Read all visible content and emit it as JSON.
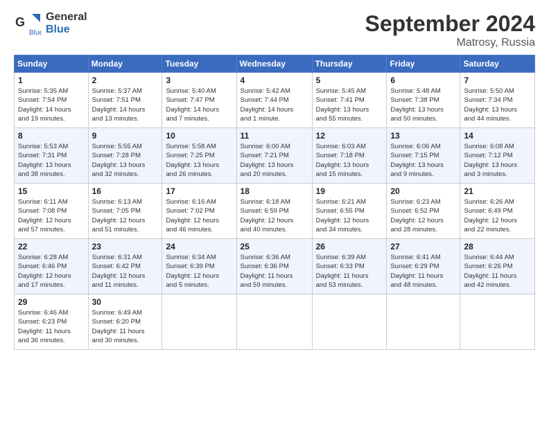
{
  "logo": {
    "line1": "General",
    "line2": "Blue"
  },
  "title": "September 2024",
  "location": "Matrosy, Russia",
  "days_of_week": [
    "Sunday",
    "Monday",
    "Tuesday",
    "Wednesday",
    "Thursday",
    "Friday",
    "Saturday"
  ],
  "weeks": [
    [
      {
        "day": "1",
        "info": "Sunrise: 5:35 AM\nSunset: 7:54 PM\nDaylight: 14 hours\nand 19 minutes."
      },
      {
        "day": "2",
        "info": "Sunrise: 5:37 AM\nSunset: 7:51 PM\nDaylight: 14 hours\nand 13 minutes."
      },
      {
        "day": "3",
        "info": "Sunrise: 5:40 AM\nSunset: 7:47 PM\nDaylight: 14 hours\nand 7 minutes."
      },
      {
        "day": "4",
        "info": "Sunrise: 5:42 AM\nSunset: 7:44 PM\nDaylight: 14 hours\nand 1 minute."
      },
      {
        "day": "5",
        "info": "Sunrise: 5:45 AM\nSunset: 7:41 PM\nDaylight: 13 hours\nand 55 minutes."
      },
      {
        "day": "6",
        "info": "Sunrise: 5:48 AM\nSunset: 7:38 PM\nDaylight: 13 hours\nand 50 minutes."
      },
      {
        "day": "7",
        "info": "Sunrise: 5:50 AM\nSunset: 7:34 PM\nDaylight: 13 hours\nand 44 minutes."
      }
    ],
    [
      {
        "day": "8",
        "info": "Sunrise: 5:53 AM\nSunset: 7:31 PM\nDaylight: 13 hours\nand 38 minutes."
      },
      {
        "day": "9",
        "info": "Sunrise: 5:55 AM\nSunset: 7:28 PM\nDaylight: 13 hours\nand 32 minutes."
      },
      {
        "day": "10",
        "info": "Sunrise: 5:58 AM\nSunset: 7:25 PM\nDaylight: 13 hours\nand 26 minutes."
      },
      {
        "day": "11",
        "info": "Sunrise: 6:00 AM\nSunset: 7:21 PM\nDaylight: 13 hours\nand 20 minutes."
      },
      {
        "day": "12",
        "info": "Sunrise: 6:03 AM\nSunset: 7:18 PM\nDaylight: 13 hours\nand 15 minutes."
      },
      {
        "day": "13",
        "info": "Sunrise: 6:06 AM\nSunset: 7:15 PM\nDaylight: 13 hours\nand 9 minutes."
      },
      {
        "day": "14",
        "info": "Sunrise: 6:08 AM\nSunset: 7:12 PM\nDaylight: 13 hours\nand 3 minutes."
      }
    ],
    [
      {
        "day": "15",
        "info": "Sunrise: 6:11 AM\nSunset: 7:08 PM\nDaylight: 12 hours\nand 57 minutes."
      },
      {
        "day": "16",
        "info": "Sunrise: 6:13 AM\nSunset: 7:05 PM\nDaylight: 12 hours\nand 51 minutes."
      },
      {
        "day": "17",
        "info": "Sunrise: 6:16 AM\nSunset: 7:02 PM\nDaylight: 12 hours\nand 46 minutes."
      },
      {
        "day": "18",
        "info": "Sunrise: 6:18 AM\nSunset: 6:59 PM\nDaylight: 12 hours\nand 40 minutes."
      },
      {
        "day": "19",
        "info": "Sunrise: 6:21 AM\nSunset: 6:55 PM\nDaylight: 12 hours\nand 34 minutes."
      },
      {
        "day": "20",
        "info": "Sunrise: 6:23 AM\nSunset: 6:52 PM\nDaylight: 12 hours\nand 28 minutes."
      },
      {
        "day": "21",
        "info": "Sunrise: 6:26 AM\nSunset: 6:49 PM\nDaylight: 12 hours\nand 22 minutes."
      }
    ],
    [
      {
        "day": "22",
        "info": "Sunrise: 6:28 AM\nSunset: 6:46 PM\nDaylight: 12 hours\nand 17 minutes."
      },
      {
        "day": "23",
        "info": "Sunrise: 6:31 AM\nSunset: 6:42 PM\nDaylight: 12 hours\nand 11 minutes."
      },
      {
        "day": "24",
        "info": "Sunrise: 6:34 AM\nSunset: 6:39 PM\nDaylight: 12 hours\nand 5 minutes."
      },
      {
        "day": "25",
        "info": "Sunrise: 6:36 AM\nSunset: 6:36 PM\nDaylight: 11 hours\nand 59 minutes."
      },
      {
        "day": "26",
        "info": "Sunrise: 6:39 AM\nSunset: 6:33 PM\nDaylight: 11 hours\nand 53 minutes."
      },
      {
        "day": "27",
        "info": "Sunrise: 6:41 AM\nSunset: 6:29 PM\nDaylight: 11 hours\nand 48 minutes."
      },
      {
        "day": "28",
        "info": "Sunrise: 6:44 AM\nSunset: 6:26 PM\nDaylight: 11 hours\nand 42 minutes."
      }
    ],
    [
      {
        "day": "29",
        "info": "Sunrise: 6:46 AM\nSunset: 6:23 PM\nDaylight: 11 hours\nand 36 minutes."
      },
      {
        "day": "30",
        "info": "Sunrise: 6:49 AM\nSunset: 6:20 PM\nDaylight: 11 hours\nand 30 minutes."
      },
      {
        "day": "",
        "info": ""
      },
      {
        "day": "",
        "info": ""
      },
      {
        "day": "",
        "info": ""
      },
      {
        "day": "",
        "info": ""
      },
      {
        "day": "",
        "info": ""
      }
    ]
  ]
}
